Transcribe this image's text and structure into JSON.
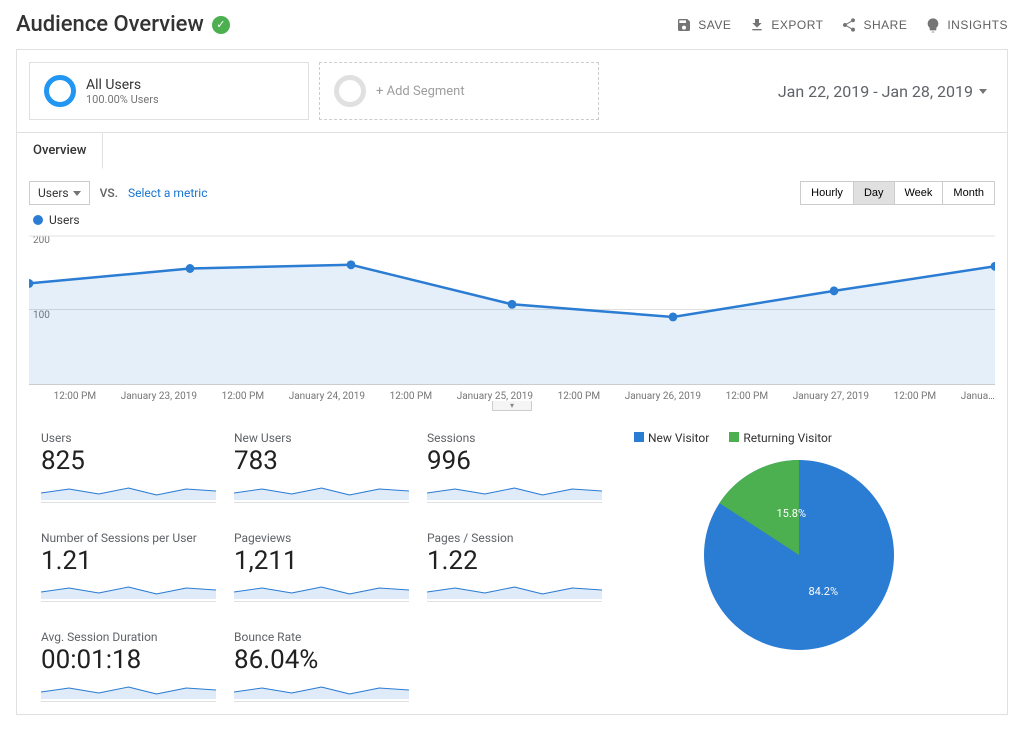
{
  "header": {
    "title": "Audience Overview",
    "actions": {
      "save": "SAVE",
      "export": "EXPORT",
      "share": "SHARE",
      "insights": "INSIGHTS"
    }
  },
  "segments": {
    "primary": {
      "title": "All Users",
      "sub": "100.00% Users"
    },
    "add": "+ Add Segment"
  },
  "date_range": "Jan 22, 2019 - Jan 28, 2019",
  "tabs": {
    "overview": "Overview"
  },
  "chart": {
    "metric_selector": "Users",
    "vs": "VS.",
    "select_metric": "Select a metric",
    "gran": {
      "hourly": "Hourly",
      "day": "Day",
      "week": "Week",
      "month": "Month"
    },
    "legend": "Users"
  },
  "chart_data": {
    "type": "line",
    "title": "Users",
    "ylabel": "",
    "ylim": [
      0,
      200
    ],
    "yticks": [
      100,
      200
    ],
    "x": [
      "",
      "12:00 PM",
      "January 23, 2019",
      "12:00 PM",
      "January 24, 2019",
      "12:00 PM",
      "January 25, 2019",
      "12:00 PM",
      "January 26, 2019",
      "12:00 PM",
      "January 27, 2019",
      "12:00 PM",
      "Janua…"
    ],
    "series": [
      {
        "name": "Users",
        "values": [
          135,
          155,
          160,
          107,
          90,
          125,
          158
        ],
        "color": "#2b7cd3"
      }
    ]
  },
  "metrics": [
    {
      "label": "Users",
      "value": "825"
    },
    {
      "label": "New Users",
      "value": "783"
    },
    {
      "label": "Sessions",
      "value": "996"
    },
    {
      "label": "Number of Sessions per User",
      "value": "1.21"
    },
    {
      "label": "Pageviews",
      "value": "1,211"
    },
    {
      "label": "Pages / Session",
      "value": "1.22"
    },
    {
      "label": "Avg. Session Duration",
      "value": "00:01:18"
    },
    {
      "label": "Bounce Rate",
      "value": "86.04%"
    }
  ],
  "pie": {
    "legend": {
      "new": "New Visitor",
      "returning": "Returning Visitor"
    },
    "slices": {
      "new": {
        "pct": 84.2,
        "label": "84.2%",
        "color": "#2b7cd3"
      },
      "returning": {
        "pct": 15.8,
        "label": "15.8%",
        "color": "#4caf50"
      }
    }
  }
}
